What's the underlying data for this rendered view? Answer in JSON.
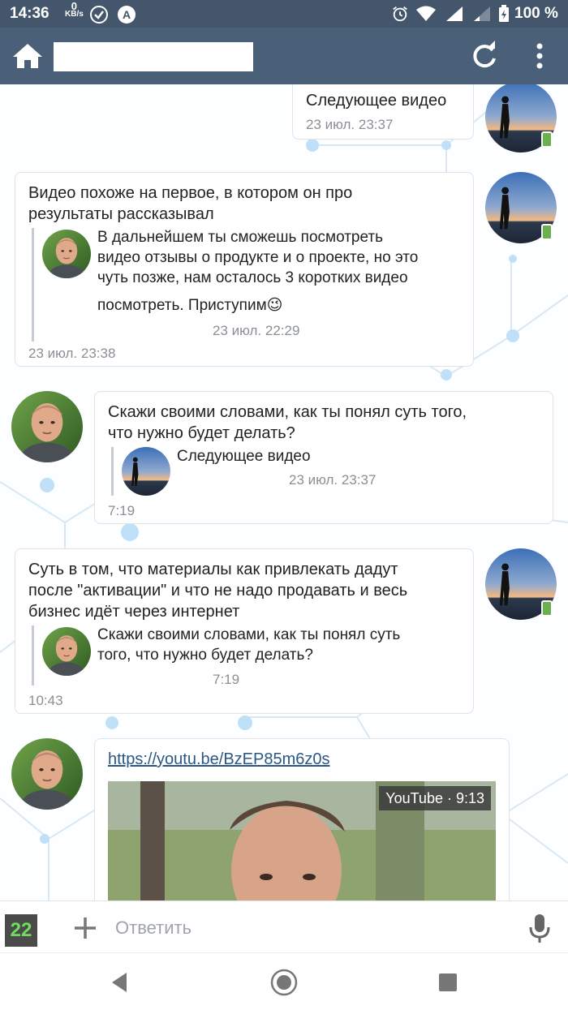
{
  "status_bar": {
    "time": "14:36",
    "net_speed_value": "0",
    "net_speed_unit": "KB/s",
    "battery_text": "100 %"
  },
  "toolbar": {
    "title": "",
    "icons": [
      "home-icon",
      "refresh-icon",
      "more-vertical-icon"
    ]
  },
  "messages": [
    {
      "side": "right",
      "text": [
        "Следующее видео"
      ],
      "time": "23 июл. 23:37"
    },
    {
      "side": "right",
      "text": [
        "Видео похоже на первое, в котором он про",
        "результаты рассказывал"
      ],
      "quote": {
        "text": [
          "В дальнейшем ты сможешь посмотреть",
          "видео отзывы о продукте и о проекте, но это",
          "чуть позже, нам осталось 3 коротких видео",
          "посмотреть. Приступим"
        ],
        "emoji": "😉",
        "time": "23 июл. 22:29"
      },
      "time": "23 июл. 23:38"
    },
    {
      "side": "left",
      "text": [
        "Скажи своими словами, как ты понял суть того,",
        "что нужно будет делать?"
      ],
      "quote": {
        "text": [
          "Следующее видео"
        ],
        "time": "23 июл. 23:37"
      },
      "time": "7:19"
    },
    {
      "side": "right",
      "text": [
        "Суть в том, что материалы как привлекать дадут",
        "после \"активации\" и что не надо продавать и весь",
        "бизнес идёт через интернет"
      ],
      "quote": {
        "text": [
          "Скажи своими словами, как ты понял суть",
          "того, что нужно будет делать?"
        ],
        "time": "7:19"
      },
      "time": "10:43"
    },
    {
      "side": "left",
      "link": "https://youtu.be/BzEP85m6z0s",
      "video_label": "YouTube · 9:13"
    }
  ],
  "input_bar": {
    "counter": "22",
    "placeholder": "Ответить",
    "icons": [
      "plus-icon",
      "microphone-icon"
    ]
  },
  "nav_bar": {
    "icons": [
      "back-icon",
      "home-circle-icon",
      "recents-icon"
    ]
  },
  "colors": {
    "status_bar": "#44566b",
    "toolbar": "#4a6079",
    "link": "#2a5885",
    "counter_text": "#6fdc5b",
    "mobile_badge": "#6ab04c"
  }
}
